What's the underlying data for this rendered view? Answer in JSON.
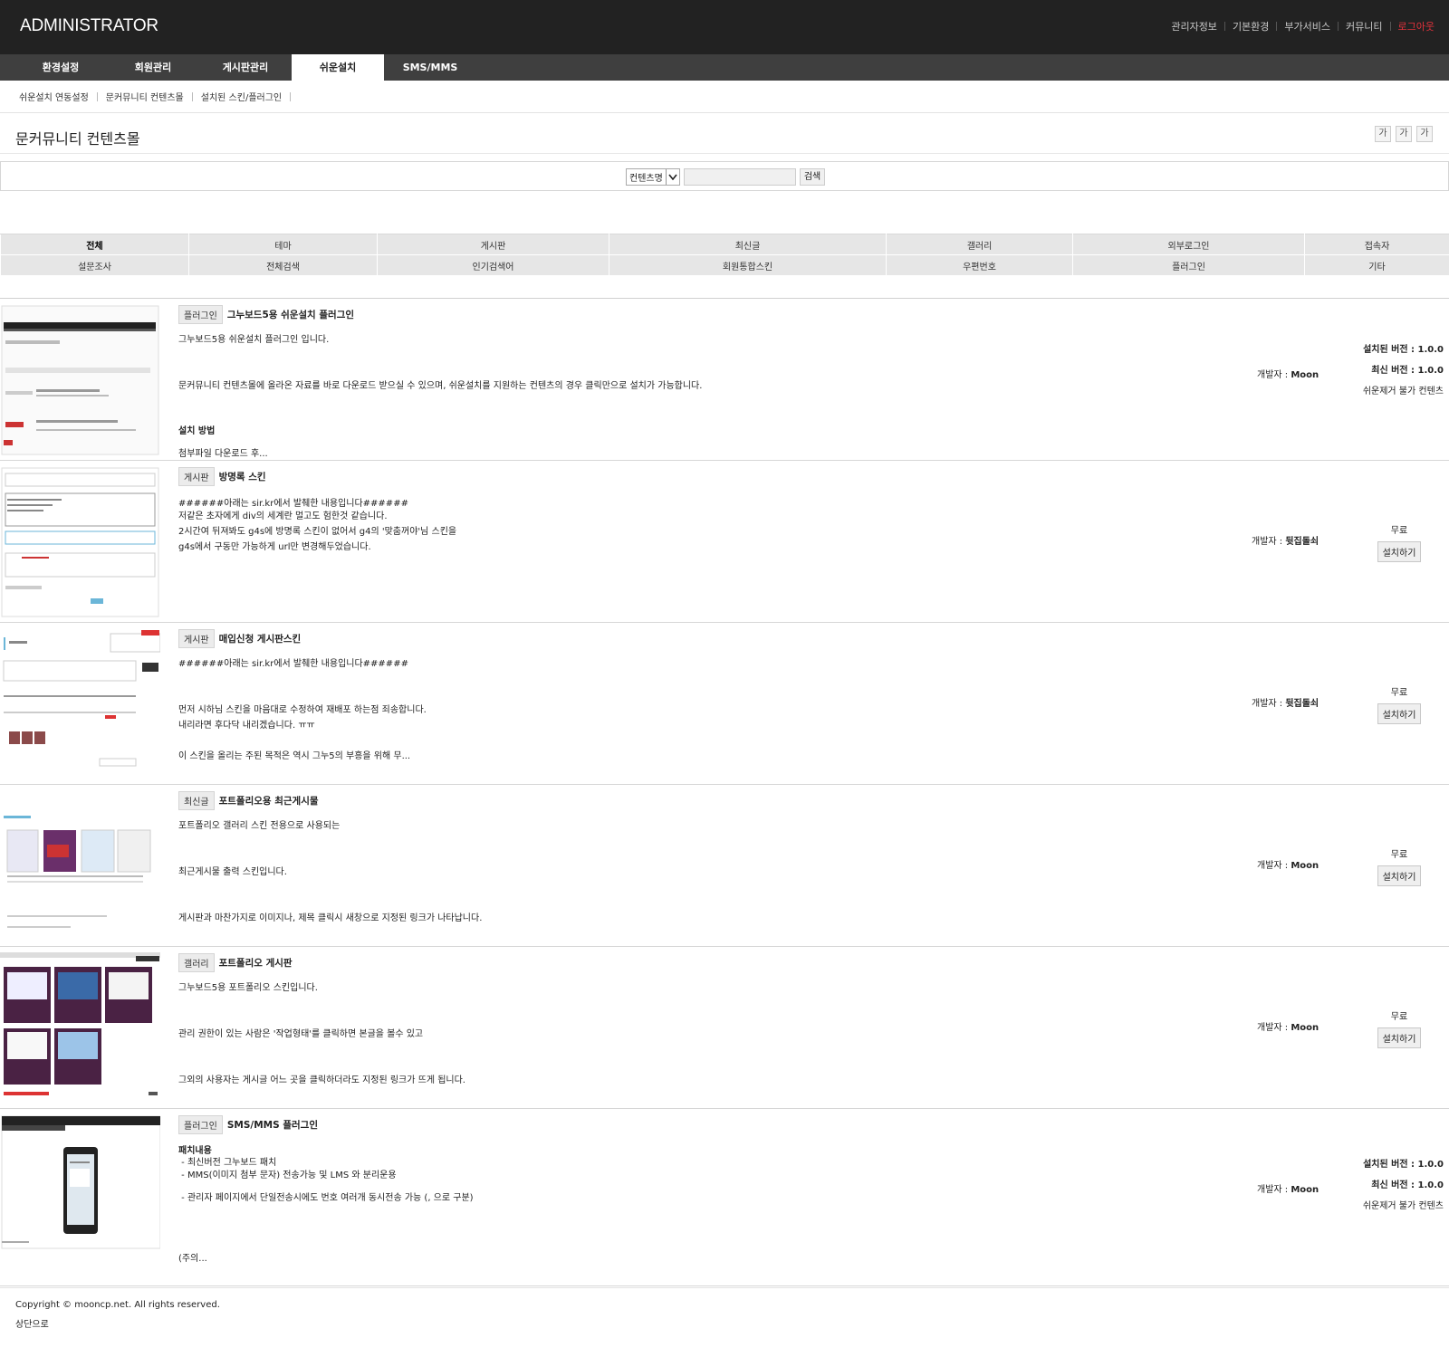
{
  "header": {
    "logo": "ADMINISTRATOR",
    "links": [
      "관리자정보",
      "기본환경",
      "부가서비스",
      "커뮤니티"
    ],
    "logout": "로그아웃"
  },
  "gnb": [
    "환경설정",
    "회원관리",
    "게시판관리",
    "쉬운설치",
    "SMS/MMS"
  ],
  "gnb_active": "쉬운설치",
  "snb": [
    "쉬운설치 연동설정",
    "문커뮤니티 컨텐츠몰",
    "설치된 스킨/플러그인"
  ],
  "page_title": "문커뮤니티 컨텐츠몰",
  "font_buttons": [
    "가",
    "가",
    "가"
  ],
  "search": {
    "select_value": "컨텐츠명",
    "button": "검색"
  },
  "categories": [
    [
      "전체",
      "테마",
      "게시판",
      "최신글",
      "갤러리",
      "외부로그인",
      "접속자"
    ],
    [
      "설문조사",
      "전체검색",
      "인기검색어",
      "회원통합스킨",
      "우편번호",
      "플러그인",
      "기타"
    ]
  ],
  "items": [
    {
      "badge": "플러그인",
      "title": "그누보드5용 쉬운설치 플러그인",
      "lines": [
        "그누보드5용 쉬운설치 플러그인 입니다.",
        "문커뮤니티 컨텐츠몰에 올라온 자료를 바로 다운로드 받으실 수 있으며, 쉬운설치를 지원하는 컨텐츠의 경우 클릭만으로 설치가 가능합니다.",
        "설치 방법",
        "첨부파일 다운로드 후..."
      ],
      "developer_label": "개발자 : ",
      "developer": "Moon",
      "installed_version": "설치된 버전 : 1.0.0",
      "latest_version": "최신 버전 : 1.0.0",
      "note": "쉬운제거 불가 컨텐츠"
    },
    {
      "badge": "게시판",
      "title": "방명록 스킨",
      "lines": [
        "######아래는 sir.kr에서 발췌한 내용입니다######",
        "저같은 초자에게 div의 세계란 멀고도 험한것 같습니다.",
        "2시간여 뒤져봐도 g4s에 방명록 스킨이 없어서 g4의 '맞춤꺼야'님 스킨을",
        "g4s에서 구동만 가능하게 url만 변경해두었습니다."
      ],
      "developer_label": "개발자 : ",
      "developer": "뒷집돌쇠",
      "price": "무료",
      "install": "설치하기"
    },
    {
      "badge": "게시판",
      "title": "매입신청 게시판스킨",
      "lines": [
        "######아래는 sir.kr에서 발췌한 내용입니다######",
        "먼저 시하님 스킨을 마음대로 수정하여 재배포 하는점 죄송합니다.",
        "내리라면 후다닥 내리겠습니다. ㅠㅠ",
        "이 스킨을 올리는 주된 목적은 역시 그누5의 부흥을 위해 무..."
      ],
      "developer_label": "개발자 : ",
      "developer": "뒷집돌쇠",
      "price": "무료",
      "install": "설치하기"
    },
    {
      "badge": "최신글",
      "title": "포트폴리오용 최근게시물",
      "lines": [
        "포트폴리오 갤러리 스킨 전용으로 사용되는",
        "최근게시물 출력 스킨입니다.",
        "게시판과 마찬가지로 이미지나, 제목 클릭시 새창으로 지정된 링크가 나타납니다."
      ],
      "developer_label": "개발자 : ",
      "developer": "Moon",
      "price": "무료",
      "install": "설치하기"
    },
    {
      "badge": "갤러리",
      "title": "포트폴리오 게시판",
      "lines": [
        "그누보드5용 포트폴리오 스킨입니다.",
        "관리 권한이 있는 사람은 '작업형태'를 클릭하면 본글을 볼수 있고",
        "그외의 사용자는 게시글 어느 곳을 클릭하더라도 지정된 링크가 뜨게 됩니다."
      ],
      "developer_label": "개발자 : ",
      "developer": "Moon",
      "price": "무료",
      "install": "설치하기"
    },
    {
      "badge": "플러그인",
      "title": "SMS/MMS 플러그인",
      "lines": [
        "패치내용",
        " - 최신버전 그누보드 패치",
        " - MMS(이미지 첨부 문자) 전송가능 및 LMS 와 분리운용",
        " - 관리자 페이지에서 단일전송시에도 번호 여러개 동시전송 가능 (, 으로 구분)",
        "(주의..."
      ],
      "developer_label": "개발자 : ",
      "developer": "Moon",
      "installed_version": "설치된 버전 : 1.0.0",
      "latest_version": "최신 버전 : 1.0.0",
      "note": "쉬운제거 불가 컨텐츠"
    }
  ],
  "footer": {
    "copyright": "Copyright © mooncp.net. All rights reserved.",
    "top": "상단으로"
  },
  "colors": {
    "header_bg": "#222222",
    "gnb_bg": "#3f3f3f",
    "logout": "#e3323c"
  }
}
